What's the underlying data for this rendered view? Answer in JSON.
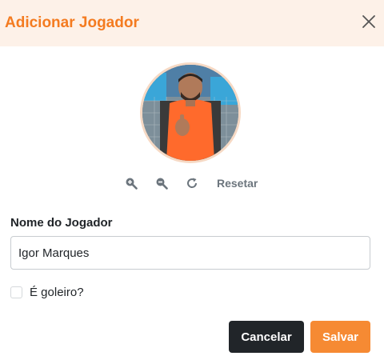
{
  "modal": {
    "title": "Adicionar Jogador",
    "accent_color": "#f47b20",
    "header_bg": "#fdf1e8"
  },
  "avatar": {
    "description_icon": "player-photo"
  },
  "tools": {
    "zoom_in_icon": "zoom-in-icon",
    "zoom_out_icon": "zoom-out-icon",
    "rotate_icon": "rotate-icon",
    "reset_label": "Resetar"
  },
  "form": {
    "name_label": "Nome do Jogador",
    "name_value": "Igor Marques",
    "goalkeeper_label": "É goleiro?",
    "goalkeeper_checked": false
  },
  "buttons": {
    "cancel_label": "Cancelar",
    "save_label": "Salvar",
    "cancel_color": "#212529",
    "save_color": "#f68a33"
  }
}
